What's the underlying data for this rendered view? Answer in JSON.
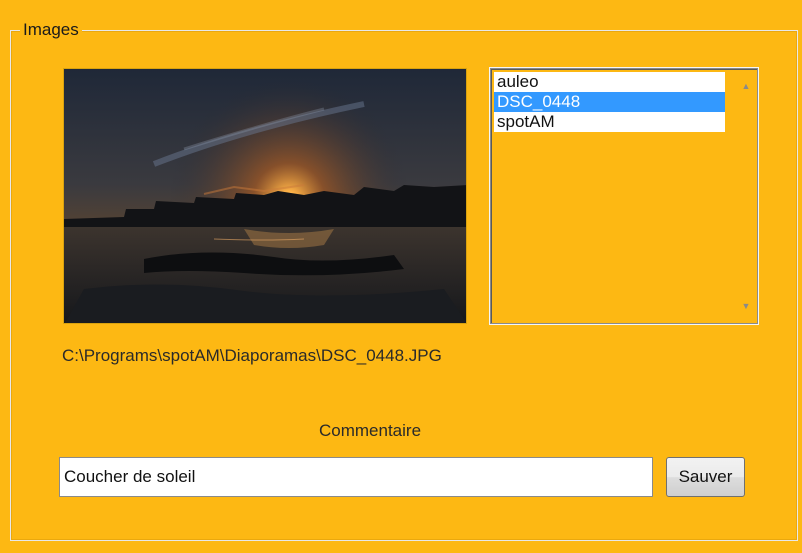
{
  "group": {
    "title": "Images"
  },
  "images_list": {
    "items": [
      "auleo",
      "DSC_0448",
      "spotAM"
    ],
    "selected_index": 1
  },
  "file_path": "C:\\Programs\\spotAM\\Diaporamas\\DSC_0448.JPG",
  "comment": {
    "label": "Commentaire",
    "value": "Coucher de soleil"
  },
  "save_button": {
    "label": "Sauver"
  },
  "colors": {
    "background": "#FDB813",
    "selection": "#3399FF"
  },
  "icons": {
    "scroll_up": "scroll-up-arrow-icon",
    "scroll_down": "scroll-down-arrow-icon"
  }
}
